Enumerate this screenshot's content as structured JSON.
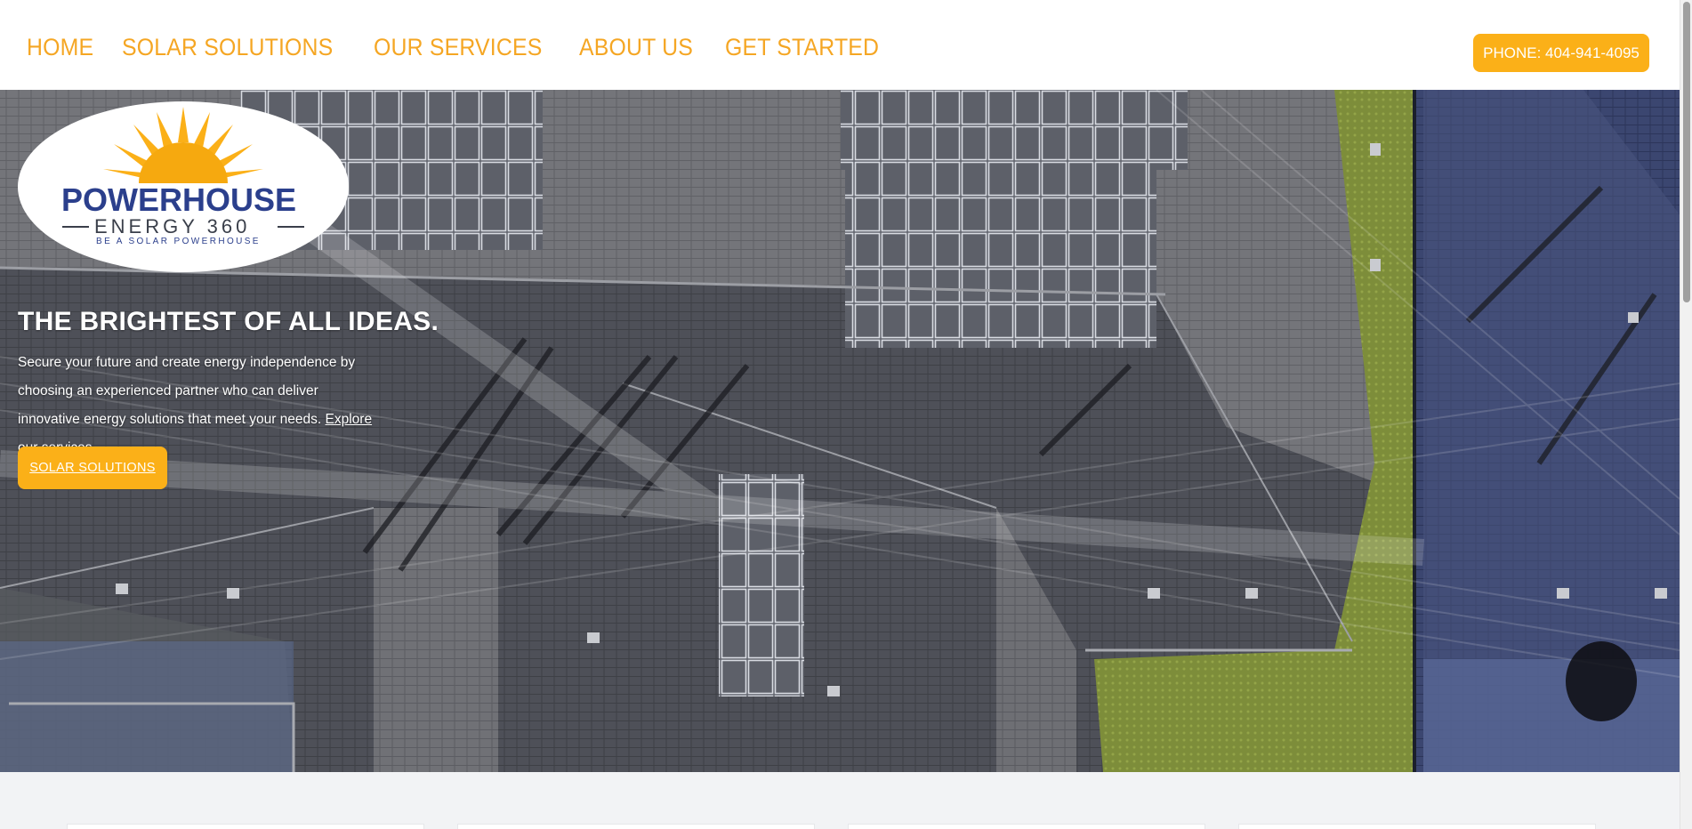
{
  "nav": {
    "items": [
      "HOME",
      "SOLAR SOLUTIONS",
      "OUR SERVICES",
      "ABOUT US",
      "GET STARTED"
    ],
    "phone_label": "PHONE: 404-941-4095"
  },
  "logo": {
    "name_line1": "POWERHOUSE",
    "name_line2": "ENERGY 360",
    "tagline": "BE A SOLAR POWERHOUSE",
    "icon": "sun-icon"
  },
  "hero": {
    "headline": "THE BRIGHTEST OF ALL IDEAS.",
    "description": "Secure your future and create energy independence by choosing an experienced partner who can deliver innovative energy solutions that meet your needs.",
    "link_text": "Explore our services.",
    "cta_label": "SOLAR SOLUTIONS",
    "background": "aerial-rooftop-solar-panels-image"
  },
  "colors": {
    "accent": "#fbb018",
    "nav_text": "#f5a623",
    "brand_blue": "#2b3f8c"
  }
}
